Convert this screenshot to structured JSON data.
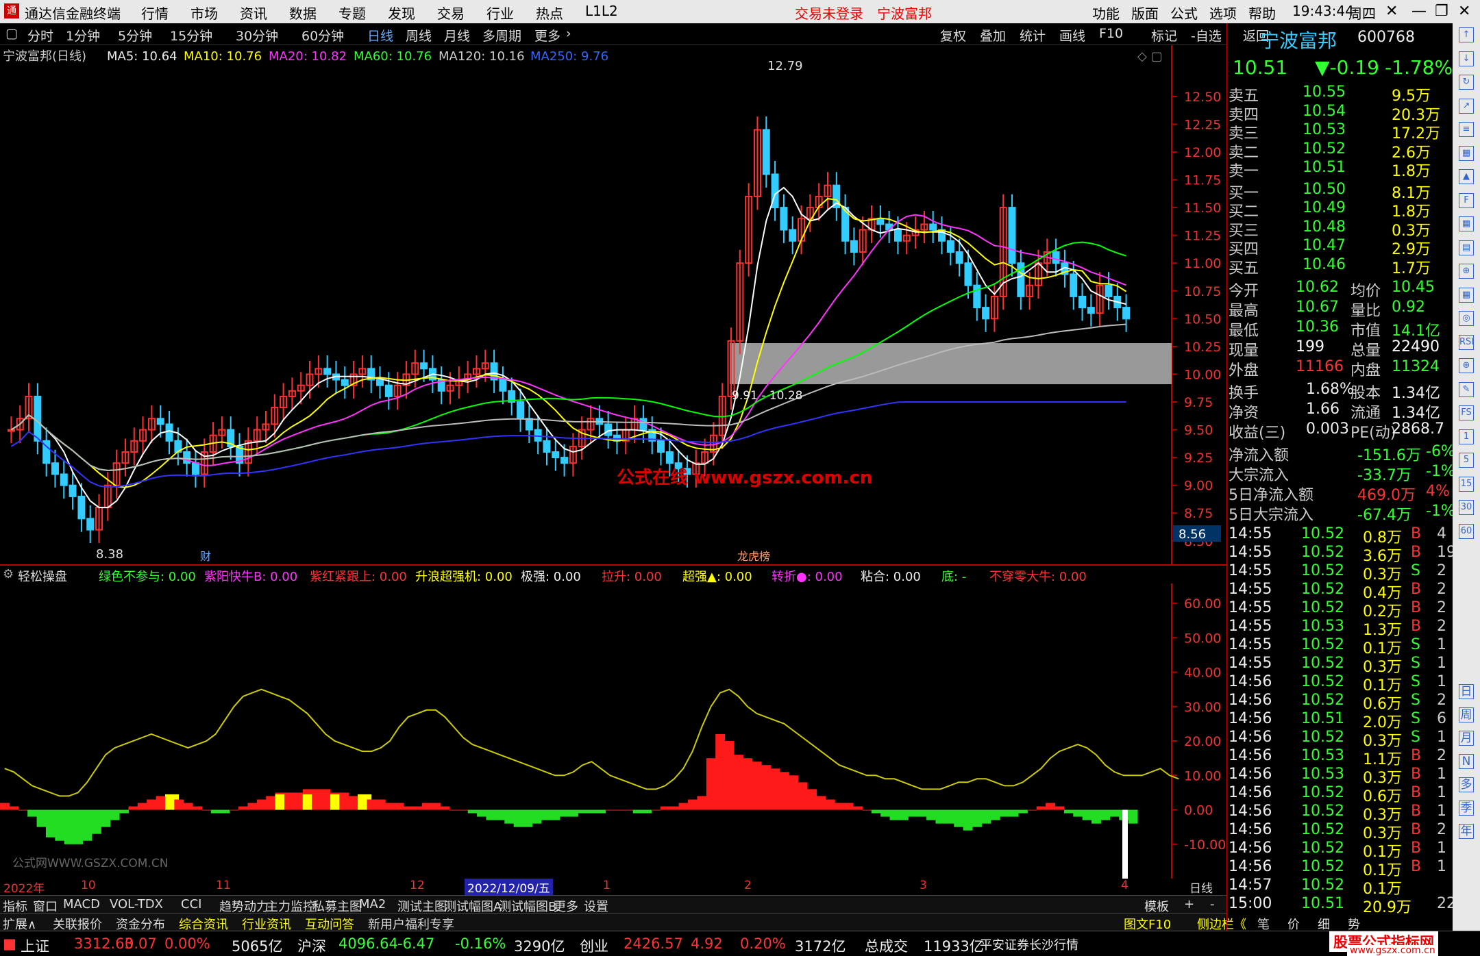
{
  "titlebar": {
    "app_title": "通达信金融终端",
    "menu": [
      "行情",
      "市场",
      "资讯",
      "数据",
      "专题",
      "发现",
      "交易",
      "行业",
      "热点",
      "L1L2"
    ],
    "login_status": "交易未登录",
    "stock_name": "宁波富邦",
    "right_menu": [
      "功能",
      "版面",
      "公式",
      "选项",
      "帮助"
    ],
    "time": "19:43:44",
    "weekday": "周四"
  },
  "toolbar": {
    "periods": [
      "分时",
      "1分钟",
      "5分钟",
      "15分钟",
      "30分钟",
      "60分钟",
      "日线",
      "周线",
      "月线",
      "多周期",
      "更多"
    ],
    "active_period": "日线",
    "tools": [
      "复权",
      "叠加",
      "统计",
      "画线",
      "F10",
      "标记",
      "-自选",
      "返回"
    ]
  },
  "ma_legend": {
    "title": "宁波富邦(日线)",
    "ma5": "MA5: 10.64",
    "ma10": "MA10: 10.76",
    "ma20": "MA20: 10.82",
    "ma60": "MA60: 10.76",
    "ma120": "MA120: 10.16",
    "ma250": "MA250: 9.76"
  },
  "chart_data": {
    "type": "candlestick",
    "title": "宁波富邦(日线)",
    "y_ticks": [
      12.5,
      12.25,
      12.0,
      11.75,
      11.5,
      11.25,
      11.0,
      10.75,
      10.5,
      10.25,
      10.0,
      9.75,
      9.5,
      9.25,
      9.0,
      8.75,
      8.5
    ],
    "ylim": [
      8.4,
      12.9
    ],
    "high_label": "12.79",
    "low_label": "8.38",
    "current_price_label": "8.56",
    "range_label": "9.91 - 10.28",
    "watermark": "公式在线 www.gszx.com.cn",
    "markers": [
      "财",
      "龙虎榜"
    ],
    "closes": [
      9.5,
      9.6,
      9.8,
      9.4,
      9.2,
      9.1,
      9.0,
      8.9,
      8.7,
      8.6,
      8.8,
      9.0,
      9.2,
      9.3,
      9.4,
      9.5,
      9.6,
      9.55,
      9.4,
      9.3,
      9.2,
      9.1,
      9.3,
      9.45,
      9.5,
      9.35,
      9.2,
      9.4,
      9.5,
      9.55,
      9.7,
      9.8,
      9.85,
      9.9,
      10.0,
      10.05,
      10.0,
      9.95,
      9.9,
      10.0,
      10.05,
      9.95,
      9.9,
      9.8,
      9.9,
      10.0,
      10.1,
      10.05,
      9.95,
      9.85,
      9.9,
      9.95,
      10.0,
      10.05,
      10.1,
      9.95,
      9.85,
      9.75,
      9.6,
      9.5,
      9.4,
      9.3,
      9.25,
      9.2,
      9.35,
      9.5,
      9.6,
      9.55,
      9.45,
      9.4,
      9.5,
      9.6,
      9.5,
      9.4,
      9.3,
      9.2,
      9.15,
      9.1,
      9.2,
      9.3,
      9.45,
      9.8,
      10.3,
      11.0,
      11.6,
      12.2,
      11.8,
      11.5,
      11.3,
      11.2,
      11.4,
      11.5,
      11.6,
      11.7,
      11.5,
      11.2,
      11.1,
      11.3,
      11.4,
      11.35,
      11.3,
      11.2,
      11.25,
      11.3,
      11.35,
      11.3,
      11.2,
      11.1,
      11.0,
      10.8,
      10.6,
      10.5,
      10.7,
      11.5,
      11.0,
      10.7,
      10.8,
      11.0,
      11.1,
      11.0,
      10.9,
      10.7,
      10.6,
      10.55,
      10.8,
      10.7,
      10.6,
      10.5
    ],
    "series": [
      {
        "name": "MA5",
        "color": "#ffffff"
      },
      {
        "name": "MA10",
        "color": "#ffff00"
      },
      {
        "name": "MA20",
        "color": "#ff33ff"
      },
      {
        "name": "MA60",
        "color": "#00ff00"
      },
      {
        "name": "MA120",
        "color": "#bbbbbb"
      },
      {
        "name": "MA250",
        "color": "#3333ff"
      }
    ]
  },
  "indicator": {
    "name": "轻松操盘",
    "labels": [
      {
        "t": "绿色不参与: 0.00",
        "c": "#3f3"
      },
      {
        "t": "紫阳快牛B: 0.00",
        "c": "#f3f"
      },
      {
        "t": "紫红紧跟上: 0.00",
        "c": "#f33"
      },
      {
        "t": "升浪超强机: 0.00",
        "c": "#ff0"
      },
      {
        "t": "极强: 0.00",
        "c": "#eee"
      },
      {
        "t": "拉升: 0.00",
        "c": "#f33"
      },
      {
        "t": "超强▲: 0.00",
        "c": "#ff0"
      },
      {
        "t": "转折●: 0.00",
        "c": "#f3f"
      },
      {
        "t": "粘合: 0.00",
        "c": "#eee"
      },
      {
        "t": "底: -",
        "c": "#3f3"
      },
      {
        "t": "不穿零大牛: 0.00",
        "c": "#f33"
      }
    ],
    "y_ticks": [
      60.0,
      50.0,
      40.0,
      30.0,
      20.0,
      10.0,
      0.0,
      -10.0
    ],
    "watermark": "公式网WWW.GSZX.COM.CN",
    "bars": [
      2,
      1,
      0,
      -2,
      -5,
      -8,
      -9,
      -10,
      -10,
      -9,
      -7,
      -5,
      -3,
      -1,
      1,
      2,
      3,
      4,
      4,
      3,
      2,
      1,
      0,
      -1,
      -1,
      0,
      1,
      2,
      3,
      4,
      5,
      5,
      5,
      6,
      6,
      6,
      5,
      5,
      4,
      4,
      3,
      3,
      2,
      2,
      1,
      1,
      2,
      2,
      1,
      0,
      0,
      -1,
      -2,
      -3,
      -3,
      -4,
      -5,
      -5,
      -4,
      -3,
      -3,
      -2,
      -2,
      -1,
      -1,
      -1,
      0,
      0,
      0,
      -1,
      -1,
      0,
      1,
      1,
      2,
      3,
      4,
      15,
      22,
      20,
      16,
      15,
      14,
      13,
      12,
      11,
      10,
      8,
      6,
      4,
      3,
      2,
      2,
      1,
      0,
      -1,
      -2,
      -3,
      -3,
      -2,
      -2,
      -3,
      -4,
      -4,
      -5,
      -6,
      -5,
      -4,
      -3,
      -2,
      -2,
      -1,
      0,
      1,
      2,
      1,
      -1,
      -2,
      -3,
      -4,
      -3,
      -2,
      -3,
      -4
    ],
    "line": [
      12,
      11,
      9,
      7,
      6,
      5,
      4,
      4,
      5,
      8,
      12,
      16,
      18,
      19,
      20,
      21,
      22,
      21,
      20,
      19,
      18,
      19,
      20,
      22,
      26,
      30,
      33,
      34,
      35,
      34,
      33,
      32,
      30,
      28,
      25,
      22,
      20,
      19,
      18,
      17,
      17,
      18,
      20,
      24,
      27,
      28,
      29,
      29,
      27,
      24,
      21,
      19,
      18,
      17,
      16,
      15,
      14,
      13,
      12,
      11,
      10,
      10,
      11,
      13,
      14,
      12,
      10,
      9,
      8,
      7,
      6,
      6,
      7,
      9,
      12,
      17,
      24,
      30,
      34,
      35,
      33,
      30,
      28,
      27,
      26,
      25,
      23,
      21,
      19,
      17,
      15,
      13,
      12,
      11,
      10,
      10,
      9,
      9,
      8,
      7,
      6,
      6,
      6,
      7,
      8,
      8,
      9,
      9,
      8,
      7,
      7,
      8,
      10,
      12,
      15,
      17,
      18,
      19,
      18,
      16,
      13,
      11,
      10,
      10,
      10,
      11,
      12,
      10,
      9
    ]
  },
  "xaxis_labels": [
    {
      "t": "2022年",
      "x": 5
    },
    {
      "t": "10",
      "x": 118
    },
    {
      "t": "11",
      "x": 315
    },
    {
      "t": "12",
      "x": 598
    },
    {
      "t": "2022/12/09/五",
      "x": 678,
      "hl": true
    },
    {
      "t": "1",
      "x": 880
    },
    {
      "t": "2",
      "x": 1086
    },
    {
      "t": "3",
      "x": 1342
    },
    {
      "t": "4",
      "x": 1636
    }
  ],
  "period_label": "日线",
  "tabs1": [
    "指标",
    "窗口",
    "MACD",
    "VOL-TDX",
    "CCI",
    "趋势动力",
    "主力监控",
    "私募主图",
    "MA2",
    "测试主图",
    "测试幅图A",
    "测试幅图B",
    "更多",
    "设置"
  ],
  "tabs1_right": [
    "模板",
    "+",
    "-"
  ],
  "tabs2": [
    "扩展∧",
    "关联报价",
    "资金分布",
    "综合资讯",
    "行业资讯",
    "互动问答",
    "新用户福利专享"
  ],
  "tabs2_right": [
    "图文F10",
    "侧边栏《",
    "笔",
    "价",
    "细",
    "势"
  ],
  "quote": {
    "name": "宁波富邦",
    "code": "600768",
    "price": "10.51",
    "change": "▼-0.19",
    "pct": "-1.78%",
    "asks": [
      [
        "卖五",
        "10.55",
        "9.5万"
      ],
      [
        "卖四",
        "10.54",
        "20.3万"
      ],
      [
        "卖三",
        "10.53",
        "17.2万"
      ],
      [
        "卖二",
        "10.52",
        "2.6万"
      ],
      [
        "卖一",
        "10.51",
        "1.8万"
      ]
    ],
    "bids": [
      [
        "买一",
        "10.50",
        "8.1万"
      ],
      [
        "买二",
        "10.49",
        "1.8万"
      ],
      [
        "买三",
        "10.48",
        "0.3万"
      ],
      [
        "买四",
        "10.47",
        "2.9万"
      ],
      [
        "买五",
        "10.46",
        "1.7万"
      ]
    ],
    "stats": [
      [
        "今开",
        "10.62",
        "均价",
        "10.45"
      ],
      [
        "最高",
        "10.67",
        "量比",
        "0.92"
      ],
      [
        "最低",
        "10.36",
        "市值",
        "14.1亿"
      ],
      [
        "现量",
        "199",
        "总量",
        "22490"
      ],
      [
        "外盘",
        "11166",
        "内盘",
        "11324"
      ]
    ],
    "stats2": [
      [
        "换手",
        "1.68%",
        "股本",
        "1.34亿"
      ],
      [
        "净资",
        "1.66",
        "流通",
        "1.34亿"
      ],
      [
        "收益(三)",
        "0.003",
        "PE(动)",
        "2868.7"
      ]
    ],
    "flows": [
      [
        "净流入额",
        "-151.6万",
        "-6%"
      ],
      [
        "大宗流入",
        "-33.7万",
        "-1%"
      ],
      [
        "5日净流入额",
        "469.0万",
        "4%"
      ],
      [
        "5日大宗流入",
        "-67.4万",
        "-1%"
      ]
    ],
    "ticks": [
      [
        "14:55",
        "10.52",
        "0.8万",
        "B",
        "4"
      ],
      [
        "14:55",
        "10.52",
        "3.6万",
        "B",
        "19"
      ],
      [
        "14:55",
        "10.52",
        "0.3万",
        "S",
        "2"
      ],
      [
        "14:55",
        "10.52",
        "0.4万",
        "B",
        "2"
      ],
      [
        "14:55",
        "10.52",
        "0.2万",
        "B",
        "2"
      ],
      [
        "14:55",
        "10.53",
        "1.3万",
        "B",
        "2"
      ],
      [
        "14:55",
        "10.52",
        "0.1万",
        "S",
        "1"
      ],
      [
        "14:55",
        "10.52",
        "0.3万",
        "S",
        "1"
      ],
      [
        "14:56",
        "10.52",
        "0.1万",
        "S",
        "1"
      ],
      [
        "14:56",
        "10.52",
        "0.6万",
        "S",
        "2"
      ],
      [
        "14:56",
        "10.51",
        "2.0万",
        "S",
        "6"
      ],
      [
        "14:56",
        "10.52",
        "0.3万",
        "S",
        "1"
      ],
      [
        "14:56",
        "10.53",
        "1.1万",
        "B",
        "2"
      ],
      [
        "14:56",
        "10.53",
        "0.3万",
        "B",
        "1"
      ],
      [
        "14:56",
        "10.52",
        "0.6万",
        "B",
        "1"
      ],
      [
        "14:56",
        "10.52",
        "0.3万",
        "B",
        "1"
      ],
      [
        "14:56",
        "10.52",
        "0.3万",
        "B",
        "2"
      ],
      [
        "14:56",
        "10.52",
        "0.1万",
        "B",
        "1"
      ],
      [
        "14:56",
        "10.52",
        "0.1万",
        "B",
        "1"
      ],
      [
        "14:57",
        "10.52",
        "0.1万",
        "",
        ""
      ],
      [
        "15:00",
        "10.51",
        "20.9万",
        "",
        "22"
      ]
    ]
  },
  "sidebar_labels": [
    "日",
    "周",
    "月",
    "N",
    "多",
    "季",
    "年"
  ],
  "sidebar_icons": [
    "↑",
    "↓",
    "↻",
    "↗",
    "≡",
    "▦",
    "▲",
    "F",
    "▦",
    "▤",
    "⊕",
    "▦",
    "◎",
    "RSI",
    "⊕",
    "✎",
    "FS",
    "1",
    "5",
    "15",
    "30",
    "60"
  ],
  "statusbar": {
    "items": [
      {
        "t": "上证",
        "c": "#eee"
      },
      {
        "t": "3312.63",
        "c": "#f33"
      },
      {
        "t": "0.07",
        "c": "#f33"
      },
      {
        "t": "0.00%",
        "c": "#f33"
      },
      {
        "t": "5065亿",
        "c": "#eee"
      },
      {
        "t": "沪深",
        "c": "#eee"
      },
      {
        "t": "4096.64",
        "c": "#3f3"
      },
      {
        "t": "-6.47",
        "c": "#3f3"
      },
      {
        "t": "-0.16%",
        "c": "#3f3"
      },
      {
        "t": "3290亿",
        "c": "#eee"
      },
      {
        "t": "创业",
        "c": "#eee"
      },
      {
        "t": "2426.57",
        "c": "#f33"
      },
      {
        "t": "4.92",
        "c": "#f33"
      },
      {
        "t": "0.20%",
        "c": "#f33"
      },
      {
        "t": "3172亿",
        "c": "#eee"
      },
      {
        "t": "总成交",
        "c": "#eee"
      },
      {
        "t": "11933亿",
        "c": "#eee"
      },
      {
        "t": "平安证券长沙行情",
        "c": "#eee"
      }
    ],
    "logo_text": "股票公式指标网",
    "logo_url": "www.gszx.com.cn"
  }
}
